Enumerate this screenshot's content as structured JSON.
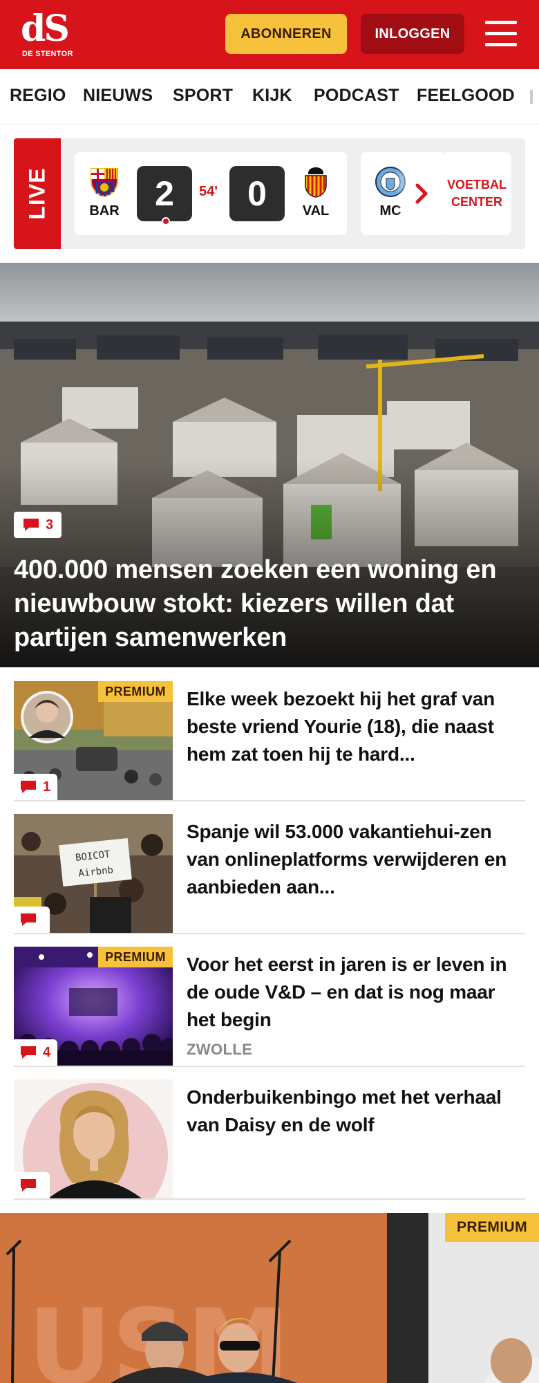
{
  "header": {
    "logo_mark": "dS",
    "logo_sub": "DE STENTOR",
    "subscribe_label": "ABONNEREN",
    "login_label": "INLOGGEN",
    "menu_icon": "hamburger-menu-icon",
    "colors": {
      "brand_red": "#d7141a",
      "subscribe_yellow": "#f7c23b",
      "login_dark_red": "#a10d12"
    }
  },
  "nav": {
    "items": [
      "REGIO",
      "NIEUWS",
      "SPORT",
      "KIJK",
      "PODCAST",
      "FEELGOOD"
    ]
  },
  "live": {
    "tag": "LIVE",
    "match": {
      "home_team": "BAR",
      "home_score": "2",
      "away_team": "VAL",
      "away_score": "0",
      "minute": "54'"
    },
    "next_match_team": "MC",
    "voetbal_center": "VOETBAL CENTER"
  },
  "hero": {
    "comments": "3",
    "title": "400.000 mensen zoeken een woning en nieuwbouw stokt: kiezers willen dat partijen samenwerken"
  },
  "articles": [
    {
      "premium": "PREMIUM",
      "comments": "1",
      "title": "Elke week bezoekt hij het graf van beste vriend Yourie (18), die naast hem zat toen hij te hard..."
    },
    {
      "premium": "",
      "comments": "",
      "title": "Spanje wil 53.000 vakantiehui-zen van onlineplatforms verwijderen en aanbieden aan..."
    },
    {
      "premium": "PREMIUM",
      "comments": "4",
      "title": "Voor het eerst in jaren is er leven in de oude V&D – en dat is nog maar het begin",
      "region": "ZWOLLE"
    },
    {
      "premium": "",
      "comments": "",
      "title": "Onderbuikenbingo met het verhaal van Daisy en de wolf"
    }
  ],
  "big_article": {
    "premium": "PREMIUM"
  }
}
